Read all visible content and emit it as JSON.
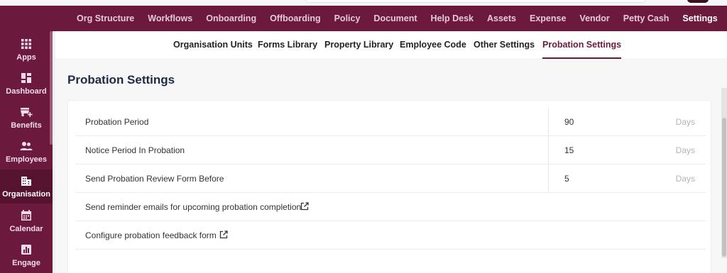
{
  "top_nav": {
    "items": [
      {
        "label": "Org Structure"
      },
      {
        "label": "Workflows"
      },
      {
        "label": "Onboarding"
      },
      {
        "label": "Offboarding"
      },
      {
        "label": "Policy"
      },
      {
        "label": "Document"
      },
      {
        "label": "Help Desk"
      },
      {
        "label": "Assets"
      },
      {
        "label": "Expense"
      },
      {
        "label": "Vendor"
      },
      {
        "label": "Petty Cash"
      },
      {
        "label": "Settings",
        "active": true
      }
    ]
  },
  "sidebar": {
    "items": [
      {
        "label": "Apps",
        "icon": "apps-grid-icon"
      },
      {
        "label": "Dashboard",
        "icon": "dashboard-icon"
      },
      {
        "label": "Benefits",
        "icon": "benefits-icon"
      },
      {
        "label": "Employees",
        "icon": "employees-icon"
      },
      {
        "label": "Organisation",
        "icon": "organisation-icon",
        "active": true
      },
      {
        "label": "Calendar",
        "icon": "calendar-icon"
      },
      {
        "label": "Engage",
        "icon": "engage-icon"
      }
    ]
  },
  "sub_tabs": {
    "items": [
      {
        "label": "Organisation Units"
      },
      {
        "label": "Forms Library"
      },
      {
        "label": "Property Library"
      },
      {
        "label": "Employee Code"
      },
      {
        "label": "Other Settings"
      },
      {
        "label": "Probation Settings",
        "active": true
      }
    ]
  },
  "page": {
    "title": "Probation Settings"
  },
  "settings": {
    "rows": [
      {
        "label": "Probation Period",
        "value": "90",
        "unit": "Days"
      },
      {
        "label": "Notice Period In Probation",
        "value": "15",
        "unit": "Days"
      },
      {
        "label": "Send Probation Review Form Before",
        "value": "5",
        "unit": "Days"
      }
    ],
    "links": [
      {
        "label": "Send reminder emails for upcoming probation completion",
        "icon": "external-link-icon"
      },
      {
        "label": "Configure probation feedback form",
        "icon": "external-link-icon"
      }
    ]
  },
  "colors": {
    "brand": "#6b1a3e",
    "brand_dark": "#551330",
    "title": "#1f2a44"
  }
}
